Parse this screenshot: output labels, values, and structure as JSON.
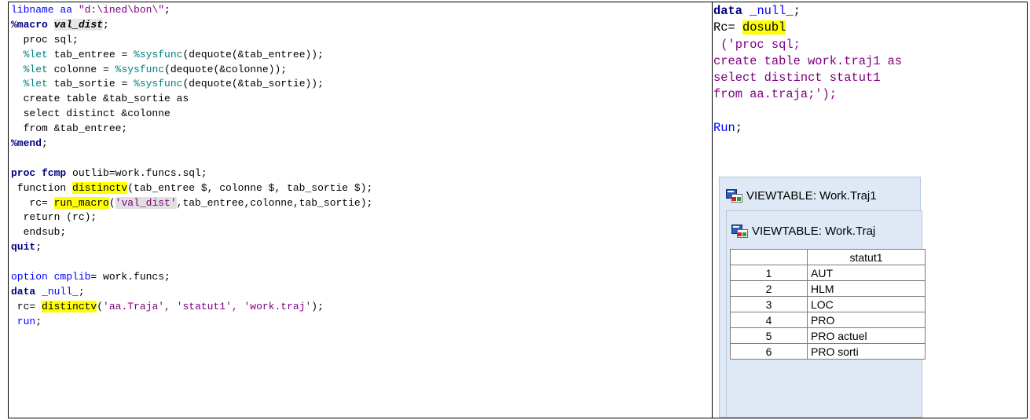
{
  "left_code": {
    "l1": [
      "libname aa ",
      "\"d:\\ined\\bon\\\"",
      ";"
    ],
    "l2": [
      "%macro",
      " ",
      "val_dist",
      ";"
    ],
    "l3": "  proc sql;",
    "l4": [
      "  ",
      "%let",
      " tab_entree = ",
      "%sysfunc",
      "(dequote(&tab_entree));"
    ],
    "l5": [
      "  ",
      "%let",
      " colonne = ",
      "%sysfunc",
      "(dequote(&colonne));"
    ],
    "l6": [
      "  ",
      "%let",
      " tab_sortie = ",
      "%sysfunc",
      "(dequote(&tab_sortie));"
    ],
    "l7": "  create table &tab_sortie as",
    "l8": "  select distinct &colonne",
    "l9": "  from &tab_entree;",
    "l10": [
      "%mend",
      ";"
    ],
    "l12": [
      "proc fcmp",
      " outlib=work.funcs.sql;"
    ],
    "l13": [
      " function ",
      "distinctv",
      "(tab_entree $, colonne $, tab_sortie $);"
    ],
    "l14": [
      "   rc= ",
      "run_macro",
      "(",
      "'val_dist'",
      ",tab_entree,colonne,tab_sortie);"
    ],
    "l15": "  return (rc);",
    "l16": "  endsub;",
    "l17": [
      "quit",
      ";"
    ],
    "l19": [
      "option cmplib",
      "= work.funcs;"
    ],
    "l20": [
      "data",
      " ",
      "_null_",
      ";"
    ],
    "l21": [
      " rc= ",
      "distinctv",
      "(",
      "'aa.Traja', 'statut1', 'work.traj'",
      ");"
    ],
    "l22": [
      " run",
      ";"
    ]
  },
  "right_code": {
    "r1": [
      "data",
      " ",
      "_null_",
      ";"
    ],
    "r2": [
      "Rc= ",
      "dosubl"
    ],
    "r3": " ('proc sql;",
    "r4": "create table work.traj1 as",
    "r5": "select distinct statut1",
    "r6": "from aa.traja;');",
    "r8": [
      "Run",
      ";"
    ]
  },
  "viewtable_outer": {
    "title": "VIEWTABLE: Work.Traj1"
  },
  "viewtable_inner": {
    "title": "VIEWTABLE: Work.Traj",
    "column_header": "statut1",
    "rows": [
      {
        "num": "1",
        "value": "AUT"
      },
      {
        "num": "2",
        "value": "HLM"
      },
      {
        "num": "3",
        "value": "LOC"
      },
      {
        "num": "4",
        "value": "PRO"
      },
      {
        "num": "5",
        "value": "PRO actuel"
      },
      {
        "num": "6",
        "value": "PRO sorti"
      }
    ]
  },
  "colors": {
    "keyword": "#000080",
    "macro_keyword": "#008080",
    "string": "#800080",
    "highlight": "#ffff00",
    "window_bg": "#dfe9f5"
  }
}
